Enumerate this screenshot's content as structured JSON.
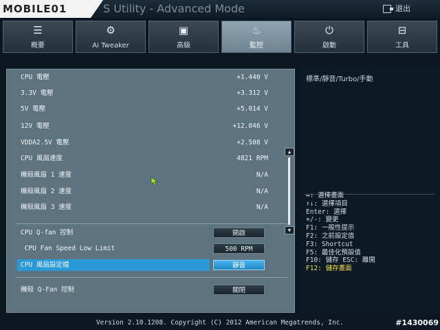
{
  "logo": "MOBILE01",
  "app_title": "S Utility - Advanced Mode",
  "exit_label": "退出",
  "tabs": [
    {
      "label": "概要",
      "icon": "list-icon"
    },
    {
      "label": "Ai Tweaker",
      "icon": "tweaker-icon"
    },
    {
      "label": "高級",
      "icon": "advanced-icon"
    },
    {
      "label": "監控",
      "icon": "monitor-icon",
      "active": true
    },
    {
      "label": "啟動",
      "icon": "power-icon"
    },
    {
      "label": "工具",
      "icon": "tool-icon"
    }
  ],
  "readings": [
    {
      "label": "CPU 電壓",
      "value": "+1.440 V"
    },
    {
      "label": "3.3V 電壓",
      "value": "+3.312 V"
    },
    {
      "label": "5V 電壓",
      "value": "+5.014 V"
    },
    {
      "label": "12V 電壓",
      "value": "+12.046 V"
    },
    {
      "label": "VDDA2.5V 電壓",
      "value": "+2.508 V"
    },
    {
      "label": "CPU 風扇速度",
      "value": "4821 RPM"
    },
    {
      "label": "機殼風扇 1 速度",
      "value": "N/A"
    },
    {
      "label": "機殼風扇 2 速度",
      "value": "N/A"
    },
    {
      "label": "機殼風扇 3 速度",
      "value": "N/A"
    }
  ],
  "options": [
    {
      "label": "CPU Q-fan 控制",
      "value": "開啟"
    },
    {
      "label": " CPU Fan Speed Low Limit",
      "value": "500 RPM"
    },
    {
      "label": "CPU 風扇設定檔",
      "value": "靜音"
    },
    {
      "label": "機殼 Q-Fan 控制",
      "value": "關閉"
    }
  ],
  "help_text": "標準/靜音/Turbo/手動",
  "key_help": [
    "↔: 選擇畫面",
    "↑↓: 選擇項目",
    "Enter: 選擇",
    "+/-: 變更",
    "F1: 一般性提示",
    "F2: 之前設定值",
    "F3: Shortcut",
    "F5: 最佳化預設值",
    "F10: 儲存  ESC: 離開",
    "F12: 儲存畫面"
  ],
  "footer": "Version 2.10.1208. Copyright (C) 2012 American Megatrends, Inc.",
  "watermark": "#1430069",
  "colors": {
    "selected": "#2a99d6",
    "panel": "#5d7380",
    "highlight_key": "#f2e14a"
  }
}
